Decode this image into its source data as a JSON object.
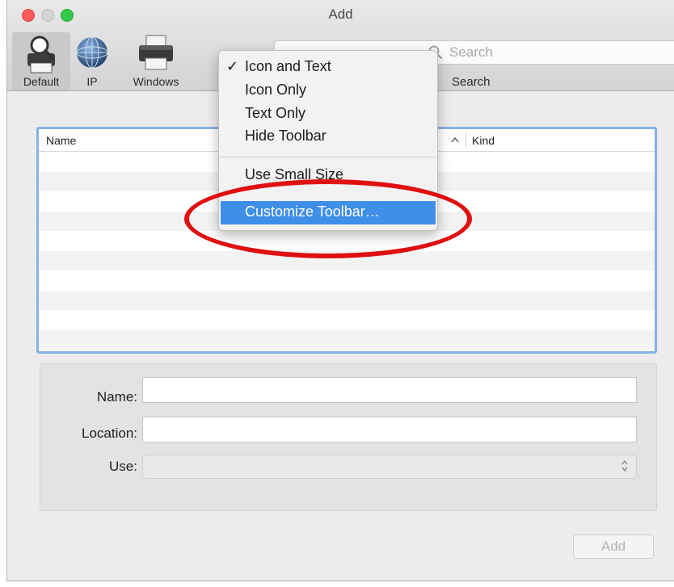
{
  "window": {
    "title": "Add"
  },
  "toolbar": {
    "items": [
      {
        "label": "Default",
        "icon": "printer-magnifier-icon"
      },
      {
        "label": "IP",
        "icon": "globe-icon"
      },
      {
        "label": "Windows",
        "icon": "printer-icon"
      }
    ],
    "search": {
      "placeholder": "Search",
      "label": "Search"
    }
  },
  "context_menu": {
    "items": [
      {
        "label": "Icon and Text",
        "checked": true
      },
      {
        "label": "Icon Only"
      },
      {
        "label": "Text Only"
      },
      {
        "label": "Hide Toolbar"
      },
      {
        "label": "Use Small Size"
      },
      {
        "label": "Customize Toolbar…",
        "highlighted": true
      }
    ],
    "check_mark": "✓"
  },
  "printer_list": {
    "columns": {
      "name": "Name",
      "kind": "Kind",
      "sort_indicator": "^"
    }
  },
  "form": {
    "name_label": "Name:",
    "location_label": "Location:",
    "use_label": "Use:",
    "name_value": "",
    "location_value": "",
    "use_value": ""
  },
  "buttons": {
    "add": "Add"
  },
  "colors": {
    "highlight": "#3f8ee8",
    "annotation": "#e01010",
    "list_focus_ring": "#84b3e4"
  }
}
